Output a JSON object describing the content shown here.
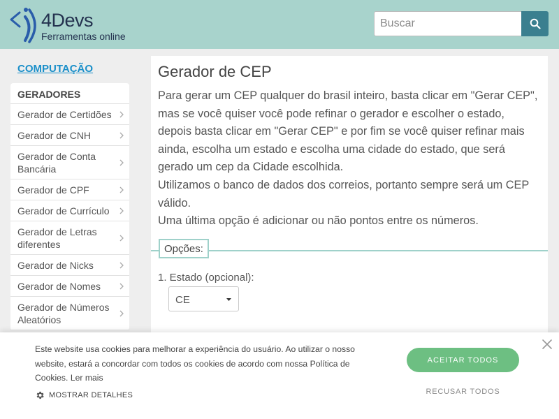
{
  "header": {
    "logo_title": "4Devs",
    "logo_subtitle": "Ferramentas online",
    "search_placeholder": "Buscar"
  },
  "sidebar": {
    "category": "COMPUTAÇÃO",
    "section": "GERADORES",
    "items": [
      {
        "label": "Gerador de Certidões"
      },
      {
        "label": "Gerador de CNH"
      },
      {
        "label": "Gerador de Conta Bancária"
      },
      {
        "label": "Gerador de CPF"
      },
      {
        "label": "Gerador de Currículo"
      },
      {
        "label": "Gerador de Letras diferentes"
      },
      {
        "label": "Gerador de Nicks"
      },
      {
        "label": "Gerador de Nomes"
      },
      {
        "label": "Gerador de Números Aleatórios"
      }
    ]
  },
  "main": {
    "title": "Gerador de CEP",
    "description": [
      "Para gerar um CEP qualquer do brasil inteiro, basta clicar em \"Gerar CEP\", mas se você quiser você pode refinar o gerador e escolher o estado, depois basta clicar em \"Gerar CEP\" e por fim se você quiser refinar mais ainda, escolha um estado e escolha uma cidade do estado, que será gerado um cep da Cidade escolhida.",
      "Utilizamos o banco de dados dos correios, portanto sempre será um CEP válido.",
      "Uma última opção é adicionar ou não pontos entre os números."
    ],
    "options_legend": "Opções:",
    "state_label": "1. Estado (opcional):",
    "state_value": "CE"
  },
  "cookie": {
    "text": "Este website usa cookies para melhorar a experiência do usuário. Ao utilizar o nosso website, estará a concordar com todos os cookies de acordo com nossa Política de Cookies.",
    "learn_more": "Ler mais",
    "details": "MOSTRAR DETALHES",
    "accept": "ACEITAR TODOS",
    "reject": "RECUSAR TODOS"
  },
  "colors": {
    "header_bg": "#a8d3cc",
    "search_button": "#3a7f8f",
    "link": "#1a8fc9",
    "accept_button": "#6dbf82",
    "fieldset_border": "#9fd1ca"
  }
}
